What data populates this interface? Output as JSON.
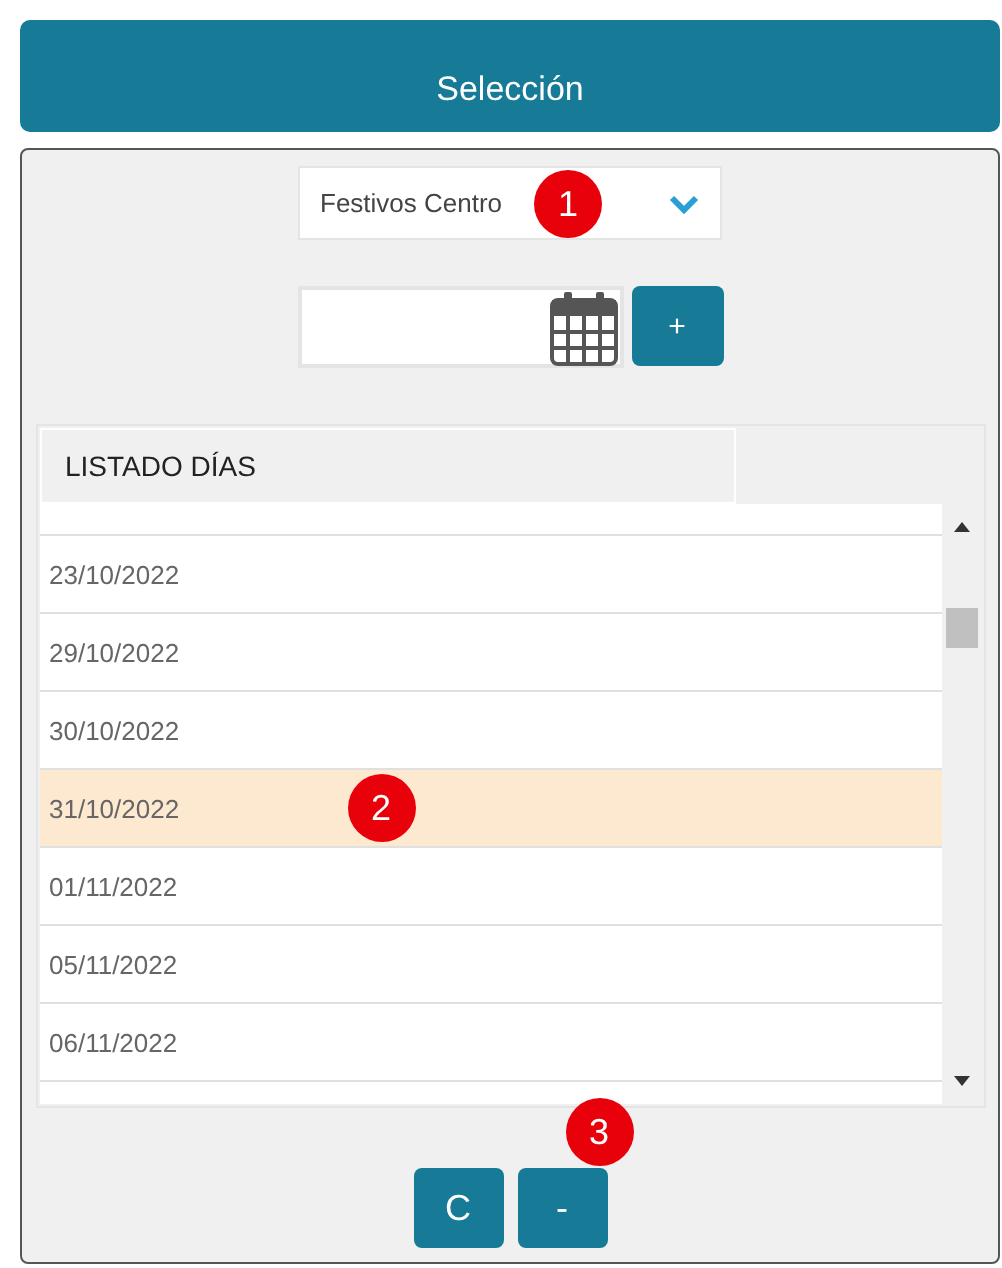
{
  "header": {
    "title": "Selección"
  },
  "dropdown": {
    "value": "Festivos Centro",
    "callout": "1"
  },
  "date_field": {
    "add_button": "+"
  },
  "list": {
    "heading": "LISTADO DÍAS",
    "rows": [
      {
        "date": "23/10/2022",
        "selected": false
      },
      {
        "date": "29/10/2022",
        "selected": false
      },
      {
        "date": "30/10/2022",
        "selected": false
      },
      {
        "date": "31/10/2022",
        "selected": true,
        "callout": "2"
      },
      {
        "date": "01/11/2022",
        "selected": false
      },
      {
        "date": "05/11/2022",
        "selected": false
      },
      {
        "date": "06/11/2022",
        "selected": false
      }
    ]
  },
  "buttons": [
    {
      "label": "C"
    },
    {
      "label": "-",
      "callout": "3"
    }
  ]
}
